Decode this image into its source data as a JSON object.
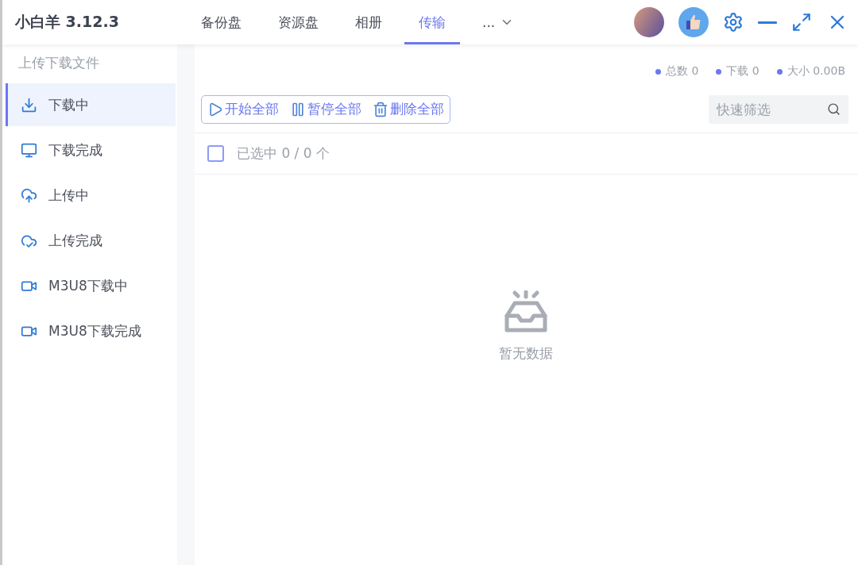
{
  "app_title": "小白羊 3.12.3",
  "tabs": [
    {
      "label": "备份盘",
      "selected": false
    },
    {
      "label": "资源盘",
      "selected": false
    },
    {
      "label": "相册",
      "selected": false
    },
    {
      "label": "传输",
      "selected": true
    },
    {
      "label": "...",
      "selected": false
    }
  ],
  "sidebar": {
    "heading": "上传下载文件",
    "items": [
      {
        "label": "下载中",
        "selected": true
      },
      {
        "label": "下载完成",
        "selected": false
      },
      {
        "label": "上传中",
        "selected": false
      },
      {
        "label": "上传完成",
        "selected": false
      },
      {
        "label": "M3U8下载中",
        "selected": false
      },
      {
        "label": "M3U8下载完成",
        "selected": false
      }
    ]
  },
  "stats": [
    "总数 0",
    "下载 0",
    "大小 0.00B"
  ],
  "toolbar": {
    "buttons": [
      "开始全部",
      "暂停全部",
      "删除全部"
    ],
    "search": {
      "placeholder": "快速筛选"
    }
  },
  "selection": {
    "checked": false,
    "label": "已选中 0 / 0 个"
  },
  "empty_state": "暂无数据"
}
